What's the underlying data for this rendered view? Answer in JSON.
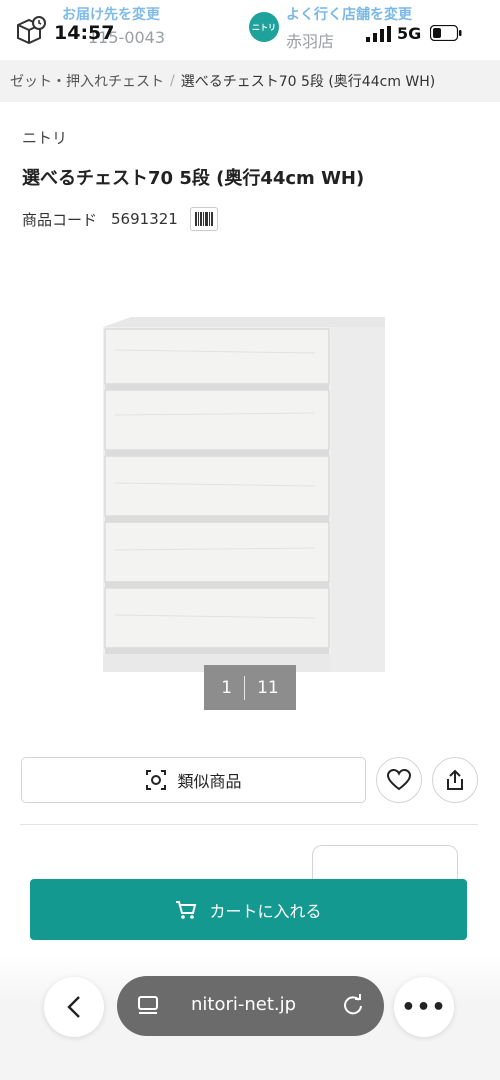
{
  "status_bar": {
    "time": "14:57",
    "delivery_label": "お届け先を変更",
    "postal_code": "115-0043",
    "store_badge": "ニトリ",
    "store_label": "よく行く店舗を変更",
    "store_name": "赤羽店",
    "network": "5G"
  },
  "breadcrumb": {
    "items": [
      "ゼット・押入れチェスト",
      "選べるチェスト70 5段 (奥行44cm WH)"
    ],
    "separator": "/"
  },
  "product": {
    "brand": "ニトリ",
    "title": "選べるチェスト70 5段 (奥行44cm WH)",
    "code_label": "商品コード",
    "code": "5691321"
  },
  "gallery": {
    "current": "1",
    "total": "11"
  },
  "actions": {
    "similar_label": "類似商品"
  },
  "cart": {
    "label": "カートに入れる",
    "color": "#13998f"
  },
  "browser": {
    "url": "nitori-net.jp"
  },
  "icons": [
    "box-icon",
    "signal-icon",
    "battery-icon",
    "barcode-icon",
    "camera-search-icon",
    "heart-icon",
    "share-icon",
    "cart-icon",
    "back-icon",
    "tabs-icon",
    "reload-icon",
    "more-icon"
  ]
}
